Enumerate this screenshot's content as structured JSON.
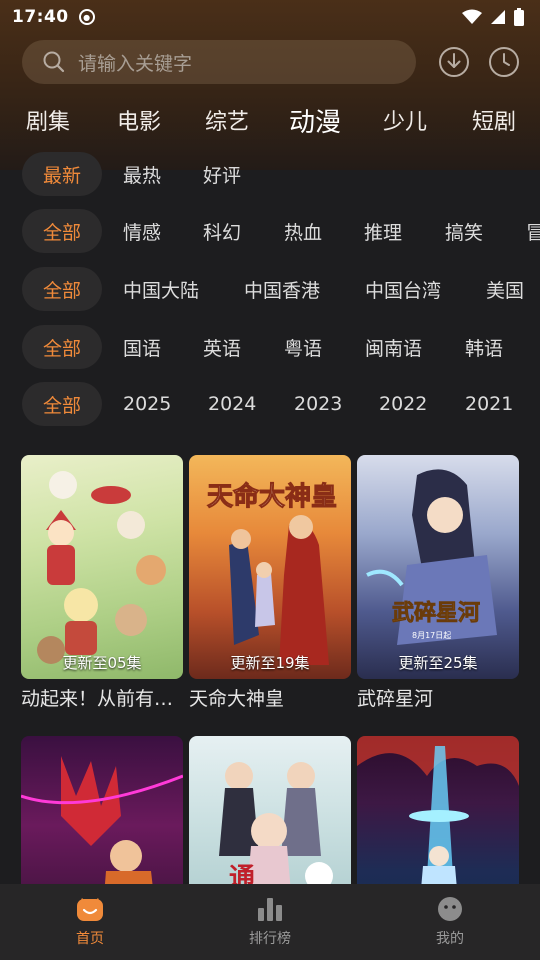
{
  "status_bar": {
    "time": "17:40"
  },
  "search": {
    "placeholder": "请输入关键字"
  },
  "category_tabs": [
    {
      "label": "剧集"
    },
    {
      "label": "电影"
    },
    {
      "label": "综艺"
    },
    {
      "label": "动漫",
      "active": true
    },
    {
      "label": "少儿"
    },
    {
      "label": "短剧"
    }
  ],
  "filters": {
    "sort": [
      "最新",
      "最热",
      "好评"
    ],
    "genre": [
      "全部",
      "情感",
      "科幻",
      "热血",
      "推理",
      "搞笑",
      "冒"
    ],
    "region": [
      "全部",
      "中国大陆",
      "中国香港",
      "中国台湾",
      "美国"
    ],
    "language": [
      "全部",
      "国语",
      "英语",
      "粤语",
      "闽南语",
      "韩语"
    ],
    "year": [
      "全部",
      "2025",
      "2024",
      "2023",
      "2022",
      "2021"
    ]
  },
  "items": [
    {
      "title": "动起来！从前有…",
      "update": "更新至05集"
    },
    {
      "title": "天命大神皇",
      "update": "更新至19集"
    },
    {
      "title": "武碎星河",
      "update": "更新至25集"
    },
    {
      "title": "",
      "update": ""
    },
    {
      "title": "",
      "update": ""
    },
    {
      "title": "",
      "update": ""
    }
  ],
  "bottom_nav": [
    {
      "label": "首页",
      "active": true
    },
    {
      "label": "排行榜"
    },
    {
      "label": "我的"
    }
  ],
  "colors": {
    "accent": "#f08a3a",
    "background": "#1d1d1f",
    "nav_bg": "#272627"
  }
}
